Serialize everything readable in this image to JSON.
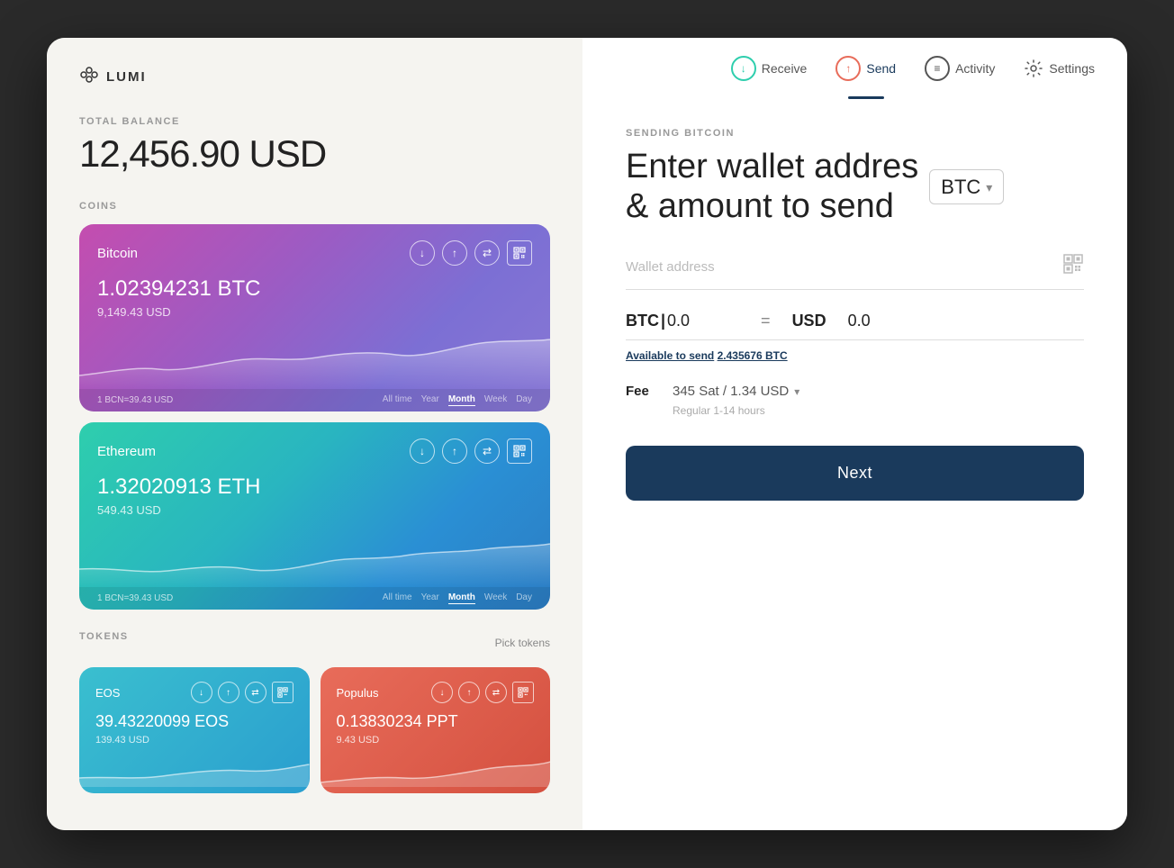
{
  "app": {
    "logo_text": "LUMI"
  },
  "left_panel": {
    "total_balance_label": "TOTAL BALANCE",
    "total_balance": "12,456.90 USD",
    "coins_label": "COINS",
    "coins": [
      {
        "name": "Bitcoin",
        "amount": "1.02394231 BTC",
        "usd": "9,149.43 USD",
        "rate": "1 BCN=39.43 USD",
        "time_filters": [
          "All time",
          "Year",
          "Month",
          "Week",
          "Day"
        ],
        "active_filter": "Month",
        "gradient_start": "#c44daf",
        "gradient_end": "#8878d4"
      },
      {
        "name": "Ethereum",
        "amount": "1.32020913 ETH",
        "usd": "549.43 USD",
        "rate": "1 BCN=39.43 USD",
        "time_filters": [
          "All time",
          "Year",
          "Month",
          "Week",
          "Day"
        ],
        "active_filter": "Month",
        "gradient_start": "#2ecead",
        "gradient_end": "#2c7dc4"
      }
    ],
    "tokens_label": "TOKENS",
    "pick_tokens": "Pick tokens",
    "tokens": [
      {
        "name": "EOS",
        "amount": "39.43220099 EOS",
        "usd": "139.43 USD"
      },
      {
        "name": "Populus",
        "amount": "0.13830234 PPT",
        "usd": "9.43 USD"
      }
    ]
  },
  "nav": {
    "receive_label": "Receive",
    "send_label": "Send",
    "activity_label": "Activity",
    "settings_label": "Settings"
  },
  "send_panel": {
    "sending_label": "SENDING BITCOIN",
    "title_line1": "Enter wallet addres",
    "title_line2": "& amount to send",
    "currency": "BTC",
    "wallet_placeholder": "Wallet address",
    "btc_label": "BTC|",
    "btc_value": "0.0",
    "equals": "=",
    "usd_label": "USD",
    "usd_value": "0.0",
    "available_label": "Available to send",
    "available_amount": "2.435676 BTC",
    "fee_label": "Fee",
    "fee_value": "345 Sat / 1.34 USD",
    "fee_note": "Regular 1-14 hours",
    "next_button": "Next"
  }
}
